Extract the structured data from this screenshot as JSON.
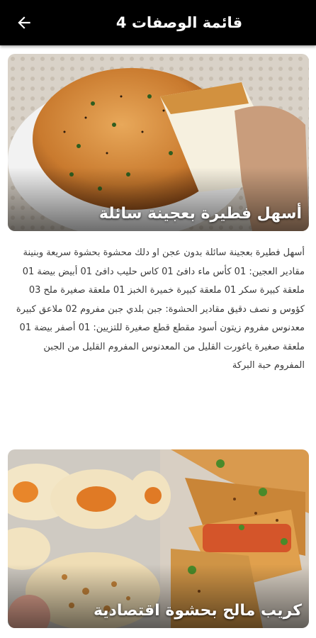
{
  "header": {
    "title": "قائمة الوصفات 4",
    "back_icon": "arrow-left-icon",
    "background": "#000000"
  },
  "recipes": [
    {
      "title": "أسهل فطيرة بعجينة سائلة",
      "description": "أسهل فطيرة بعجينة سائلة بدون عجن او دلك محشوة بحشوة سريعة وبنينة مقادير العجين: 01 كأس ماء دافئ 01 كاس حليب دافئ 01 أبيض بيضة 01 ملعقة كبيرة سكر 01 ملعقة كبيرة خميرة الخبز 01 ملعقة صغيرة ملح 03 كؤوس و نصف دقيق مقادير الحشوة: جبن بلدي جبن مفروم 02 ملاعق كبيرة معدنوس مفروم زيتون أسود مقطع قطع صغيرة للتزيين: 01 أصفر بيضة 01 ملعقة صغيرة ياغورت القليل من المعدنوس المفروم القليل من الجبن المفروم حبة البركة"
    },
    {
      "title": "كريب مالح بحشوة اقتصادية"
    }
  ]
}
